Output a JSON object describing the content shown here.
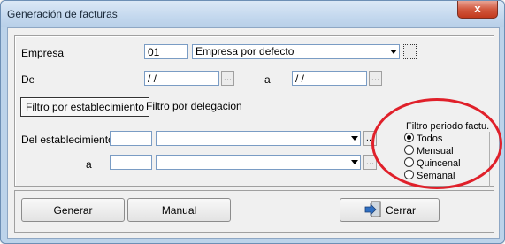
{
  "window": {
    "title": "Generación de facturas",
    "close_label": "x"
  },
  "form": {
    "empresa_label": "Empresa",
    "empresa_code": "01",
    "empresa_name": "Empresa por defecto",
    "de_label": "De",
    "de_value": " / /",
    "a_label": "a",
    "a_value": " / /",
    "ellipsis": "..."
  },
  "tabs": [
    {
      "label": "Filtro por establecimiento",
      "active": true
    },
    {
      "label": "Filtro por delegacion",
      "active": false
    }
  ],
  "establecimiento": {
    "del_label": "Del establecimiento",
    "a_label": "a"
  },
  "periodo": {
    "title": "Filtro periodo factu.",
    "options": [
      {
        "label": "Todos",
        "selected": true
      },
      {
        "label": "Mensual",
        "selected": false
      },
      {
        "label": "Quincenal",
        "selected": false
      },
      {
        "label": "Semanal",
        "selected": false
      }
    ]
  },
  "buttons": {
    "generar": "Generar",
    "manual": "Manual",
    "cerrar": "Cerrar"
  },
  "colors": {
    "annotation_circle": "#e0202a",
    "titlebar": "#c4d8ee"
  }
}
